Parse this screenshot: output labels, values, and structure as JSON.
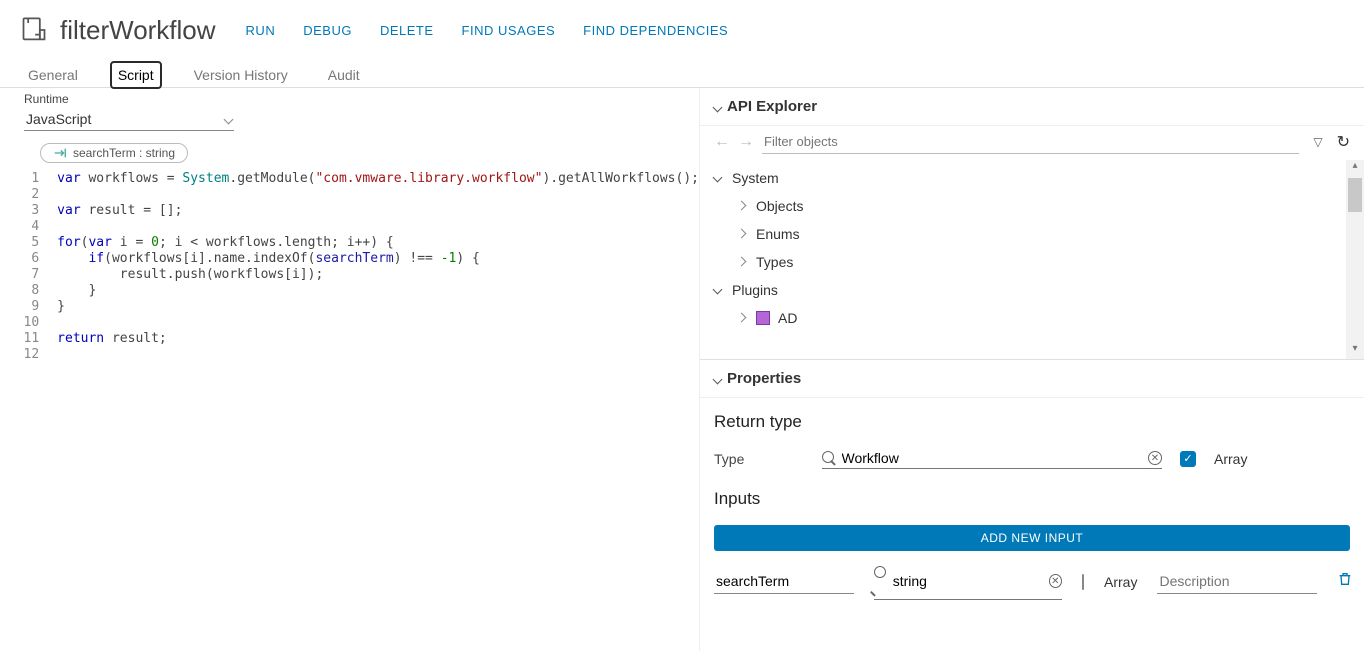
{
  "header": {
    "title": "filterWorkflow",
    "actions": {
      "run": "RUN",
      "debug": "DEBUG",
      "delete": "DELETE",
      "find_usages": "FIND USAGES",
      "find_deps": "FIND DEPENDENCIES"
    }
  },
  "tabs": {
    "general": "General",
    "script": "Script",
    "version": "Version History",
    "audit": "Audit"
  },
  "runtime": {
    "label": "Runtime",
    "value": "JavaScript"
  },
  "chip": {
    "label": "searchTerm : string"
  },
  "code": {
    "lines": [
      "1",
      "2",
      "3",
      "4",
      "5",
      "6",
      "7",
      "8",
      "9",
      "10",
      "11",
      "12"
    ],
    "kw_var": "var",
    "kw_for": "for",
    "kw_if": "if",
    "kw_return": "return",
    "ident_system": "System",
    "str_module": "\"com.vmware.library.workflow\"",
    "ident_searchterm": "searchTerm",
    "num_neg1": "-1",
    "num_zero": "0",
    "l1_a": " workflows = ",
    "l1_b": ".getModule(",
    "l1_c": ").getAllWorkflows();",
    "l3_a": " result = [];",
    "l5_a": "(",
    "l5_b": " i = ",
    "l5_c": "; i < workflows.length; i++) {",
    "l6_a": "    ",
    "l6_b": "(workflows[i].name.indexOf(",
    "l6_c": ") !== ",
    "l6_d": ") {",
    "l7": "        result.push(workflows[i]);",
    "l8": "    }",
    "l9": "}",
    "l11_a": " result;"
  },
  "api": {
    "title": "API Explorer",
    "filter_ph": "Filter objects",
    "system": "System",
    "objects": "Objects",
    "enums": "Enums",
    "types": "Types",
    "plugins": "Plugins",
    "ad": "AD"
  },
  "props": {
    "title": "Properties",
    "return_h": "Return type",
    "type_lbl": "Type",
    "type_val": "Workflow",
    "array_lbl": "Array",
    "inputs_h": "Inputs",
    "add_btn": "ADD NEW INPUT",
    "in_name": "searchTerm",
    "in_type": "string",
    "in_array_lbl": "Array",
    "desc_ph": "Description"
  }
}
